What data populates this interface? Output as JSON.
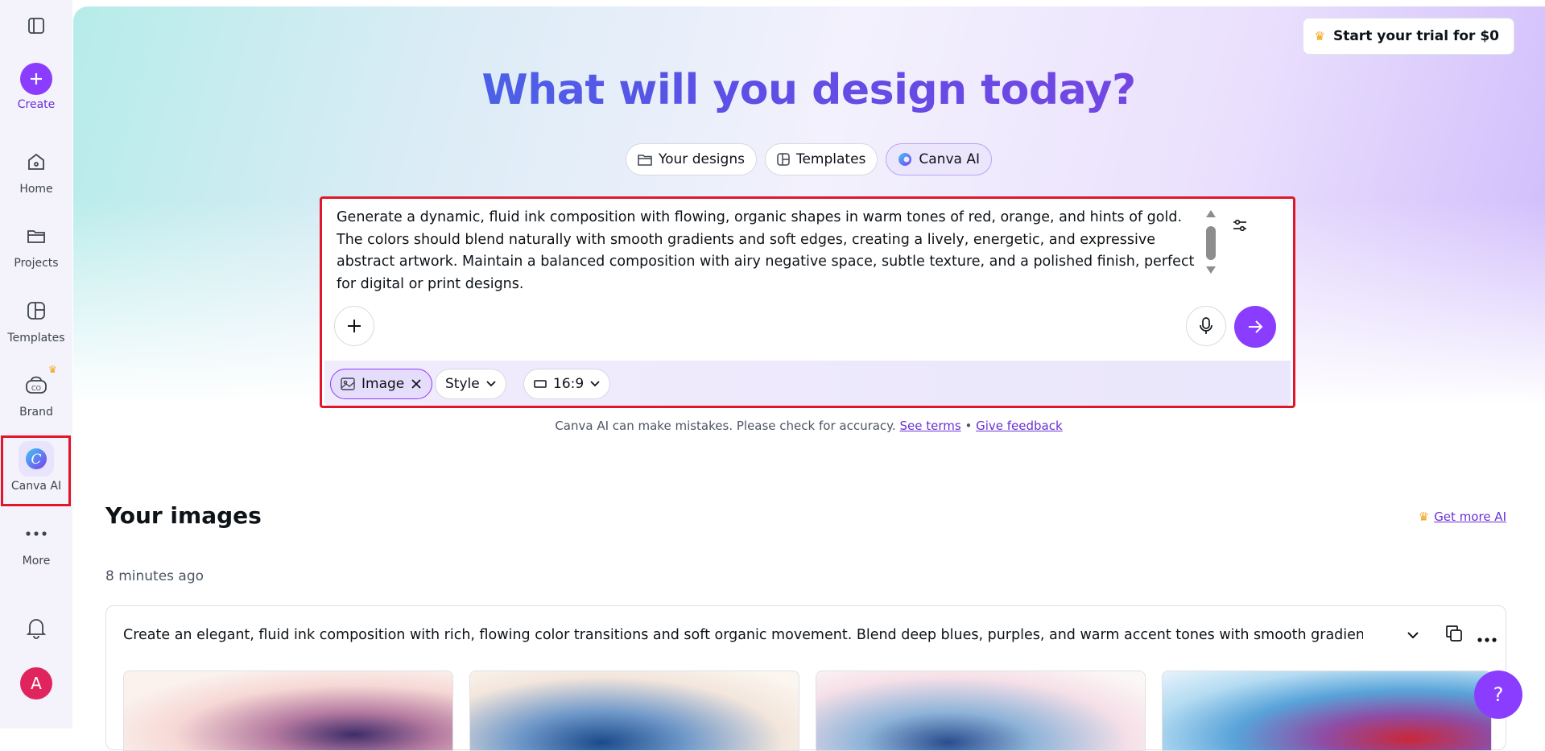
{
  "sidebar": {
    "create_label": "Create",
    "items": [
      {
        "label": "Home"
      },
      {
        "label": "Projects"
      },
      {
        "label": "Templates"
      },
      {
        "label": "Brand"
      },
      {
        "label": "Canva AI"
      },
      {
        "label": "More"
      }
    ],
    "avatar_letter": "A"
  },
  "header": {
    "trial_label": "Start your trial for $0",
    "title": "What will you design today?"
  },
  "chips": [
    {
      "label": "Your designs",
      "icon": "folder-icon"
    },
    {
      "label": "Templates",
      "icon": "template-icon"
    },
    {
      "label": "Canva AI",
      "icon": "canva-ai-icon",
      "active": true
    }
  ],
  "prompt": {
    "text": "Generate a dynamic, fluid ink composition with flowing, organic shapes in warm tones of red, orange, and hints of gold. The colors should blend naturally with smooth gradients and soft edges, creating a lively, energetic, and expressive abstract artwork. Maintain a balanced composition with airy negative space, subtle texture, and a polished finish, perfect for digital or print designs.",
    "options": {
      "image_label": "Image",
      "style_label": "Style",
      "ratio_label": "16:9"
    }
  },
  "disclaimer": {
    "text": "Canva AI can make mistakes. Please check for accuracy.",
    "see_terms": "See terms",
    "separator": "•",
    "feedback": "Give feedback"
  },
  "images_section": {
    "title": "Your images",
    "get_more": "Get more AI",
    "time": "8 minutes ago",
    "card_prompt": "Create an elegant, fluid ink composition with rich, flowing color transitions and soft organic movement. Blend deep blues, purples, and warm accent tones with smooth gradients a..."
  },
  "help_label": "?",
  "colors": {
    "accent": "#8b3dff",
    "highlight": "#e0162b",
    "link": "#6a2fd6"
  }
}
